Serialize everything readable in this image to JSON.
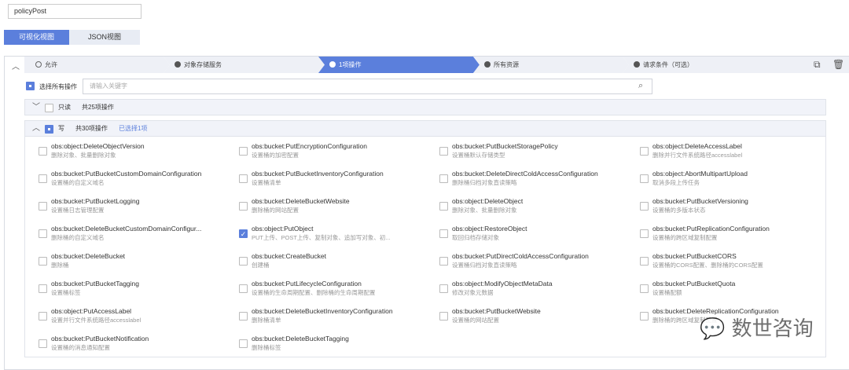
{
  "policy_name": "policyPost",
  "view_tabs": [
    "可视化视图",
    "JSON视图"
  ],
  "steps": [
    {
      "label": "允许",
      "state": "done"
    },
    {
      "label": "对象存储服务",
      "state": "done"
    },
    {
      "label": "1项操作",
      "state": "active"
    },
    {
      "label": "所有资源",
      "state": "pending"
    },
    {
      "label": "请求条件（可选）",
      "state": "pending"
    }
  ],
  "select_all_label": "选择所有操作",
  "search_placeholder": "请输入关键字",
  "readonly_group": {
    "title": "只读",
    "count": "共25项操作"
  },
  "write_group": {
    "title": "写",
    "count": "共30项操作",
    "selected": "已选择1项"
  },
  "actions": [
    {
      "name": "obs:object:DeleteObjectVersion",
      "desc": "删除对象、批量删除对象",
      "checked": false
    },
    {
      "name": "obs:bucket:PutEncryptionConfiguration",
      "desc": "设置桶的加密配置",
      "checked": false
    },
    {
      "name": "obs:bucket:PutBucketStoragePolicy",
      "desc": "设置桶默认存储类型",
      "checked": false
    },
    {
      "name": "obs:object:DeleteAccessLabel",
      "desc": "删除并行文件系统路径accesslabel",
      "checked": false
    },
    {
      "name": "obs:bucket:PutBucketCustomDomainConfiguration",
      "desc": "设置桶的自定义域名",
      "checked": false
    },
    {
      "name": "obs:bucket:PutBucketInventoryConfiguration",
      "desc": "设置桶清单",
      "checked": false
    },
    {
      "name": "obs:bucket:DeleteDirectColdAccessConfiguration",
      "desc": "删除桶归档对象直读策略",
      "checked": false
    },
    {
      "name": "obs:object:AbortMultipartUpload",
      "desc": "取消多段上传任务",
      "checked": false
    },
    {
      "name": "obs:bucket:PutBucketLogging",
      "desc": "设置桶日志管理配置",
      "checked": false
    },
    {
      "name": "obs:bucket:DeleteBucketWebsite",
      "desc": "删除桶的网站配置",
      "checked": false
    },
    {
      "name": "obs:object:DeleteObject",
      "desc": "删除对象、批量删除对象",
      "checked": false
    },
    {
      "name": "obs:bucket:PutBucketVersioning",
      "desc": "设置桶的多版本状态",
      "checked": false
    },
    {
      "name": "obs:bucket:DeleteBucketCustomDomainConfigur...",
      "desc": "删除桶的自定义域名",
      "checked": false
    },
    {
      "name": "obs:object:PutObject",
      "desc": "PUT上传、POST上传、复制对象、追加写对象、初...",
      "checked": true
    },
    {
      "name": "obs:object:RestoreObject",
      "desc": "取回归档存储对象",
      "checked": false
    },
    {
      "name": "obs:bucket:PutReplicationConfiguration",
      "desc": "设置桶的跨区域复制配置",
      "checked": false
    },
    {
      "name": "obs:bucket:DeleteBucket",
      "desc": "删除桶",
      "checked": false
    },
    {
      "name": "obs:bucket:CreateBucket",
      "desc": "创建桶",
      "checked": false
    },
    {
      "name": "obs:bucket:PutDirectColdAccessConfiguration",
      "desc": "设置桶归档对象直读策略",
      "checked": false
    },
    {
      "name": "obs:bucket:PutBucketCORS",
      "desc": "设置桶的CORS配置、删除桶的CORS配置",
      "checked": false
    },
    {
      "name": "obs:bucket:PutBucketTagging",
      "desc": "设置桶标签",
      "checked": false
    },
    {
      "name": "obs:bucket:PutLifecycleConfiguration",
      "desc": "设置桶的生命周期配置、删除桶的生命周期配置",
      "checked": false
    },
    {
      "name": "obs:object:ModifyObjectMetaData",
      "desc": "修改对象元数据",
      "checked": false
    },
    {
      "name": "obs:bucket:PutBucketQuota",
      "desc": "设置桶配额",
      "checked": false
    },
    {
      "name": "obs:object:PutAccessLabel",
      "desc": "设置并行文件系统路径accesslabel",
      "checked": false
    },
    {
      "name": "obs:bucket:DeleteBucketInventoryConfiguration",
      "desc": "删除桶清单",
      "checked": false
    },
    {
      "name": "obs:bucket:PutBucketWebsite",
      "desc": "设置桶的网站配置",
      "checked": false
    },
    {
      "name": "obs:bucket:DeleteReplicationConfiguration",
      "desc": "删除桶的跨区域复制配置",
      "checked": false
    },
    {
      "name": "obs:bucket:PutBucketNotification",
      "desc": "设置桶的消息通知配置",
      "checked": false
    },
    {
      "name": "obs:bucket:DeleteBucketTagging",
      "desc": "删除桶标签",
      "checked": false
    }
  ],
  "watermark": "数世咨询",
  "accent_color": "#5b7fdc"
}
